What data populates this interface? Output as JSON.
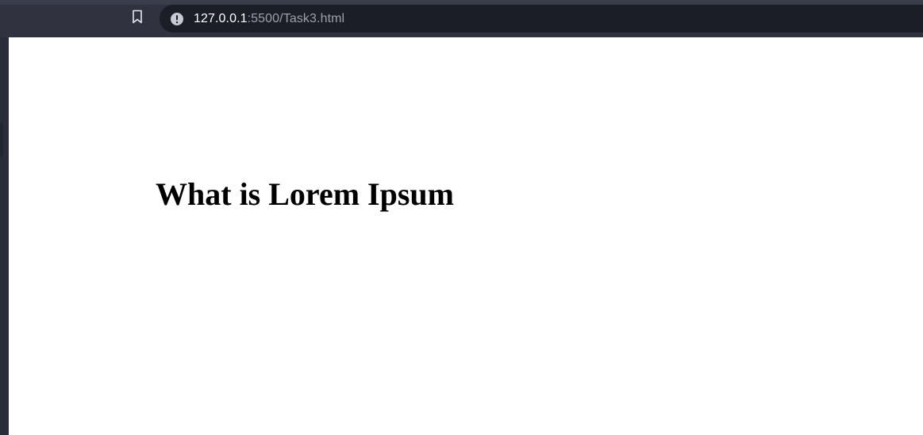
{
  "browser": {
    "address_bar": {
      "url_host": "127.0.0.1",
      "url_rest": ":5500/Task3.html"
    },
    "icons": {
      "bookmark": "bookmark-icon",
      "site_info": "info-icon"
    },
    "colors": {
      "toolbar": "#30323f",
      "address_bar": "#1c1e27",
      "url_host": "#ffffff",
      "url_rest": "#9aa0ab"
    }
  },
  "page": {
    "heading": "What is Lorem Ipsum"
  }
}
